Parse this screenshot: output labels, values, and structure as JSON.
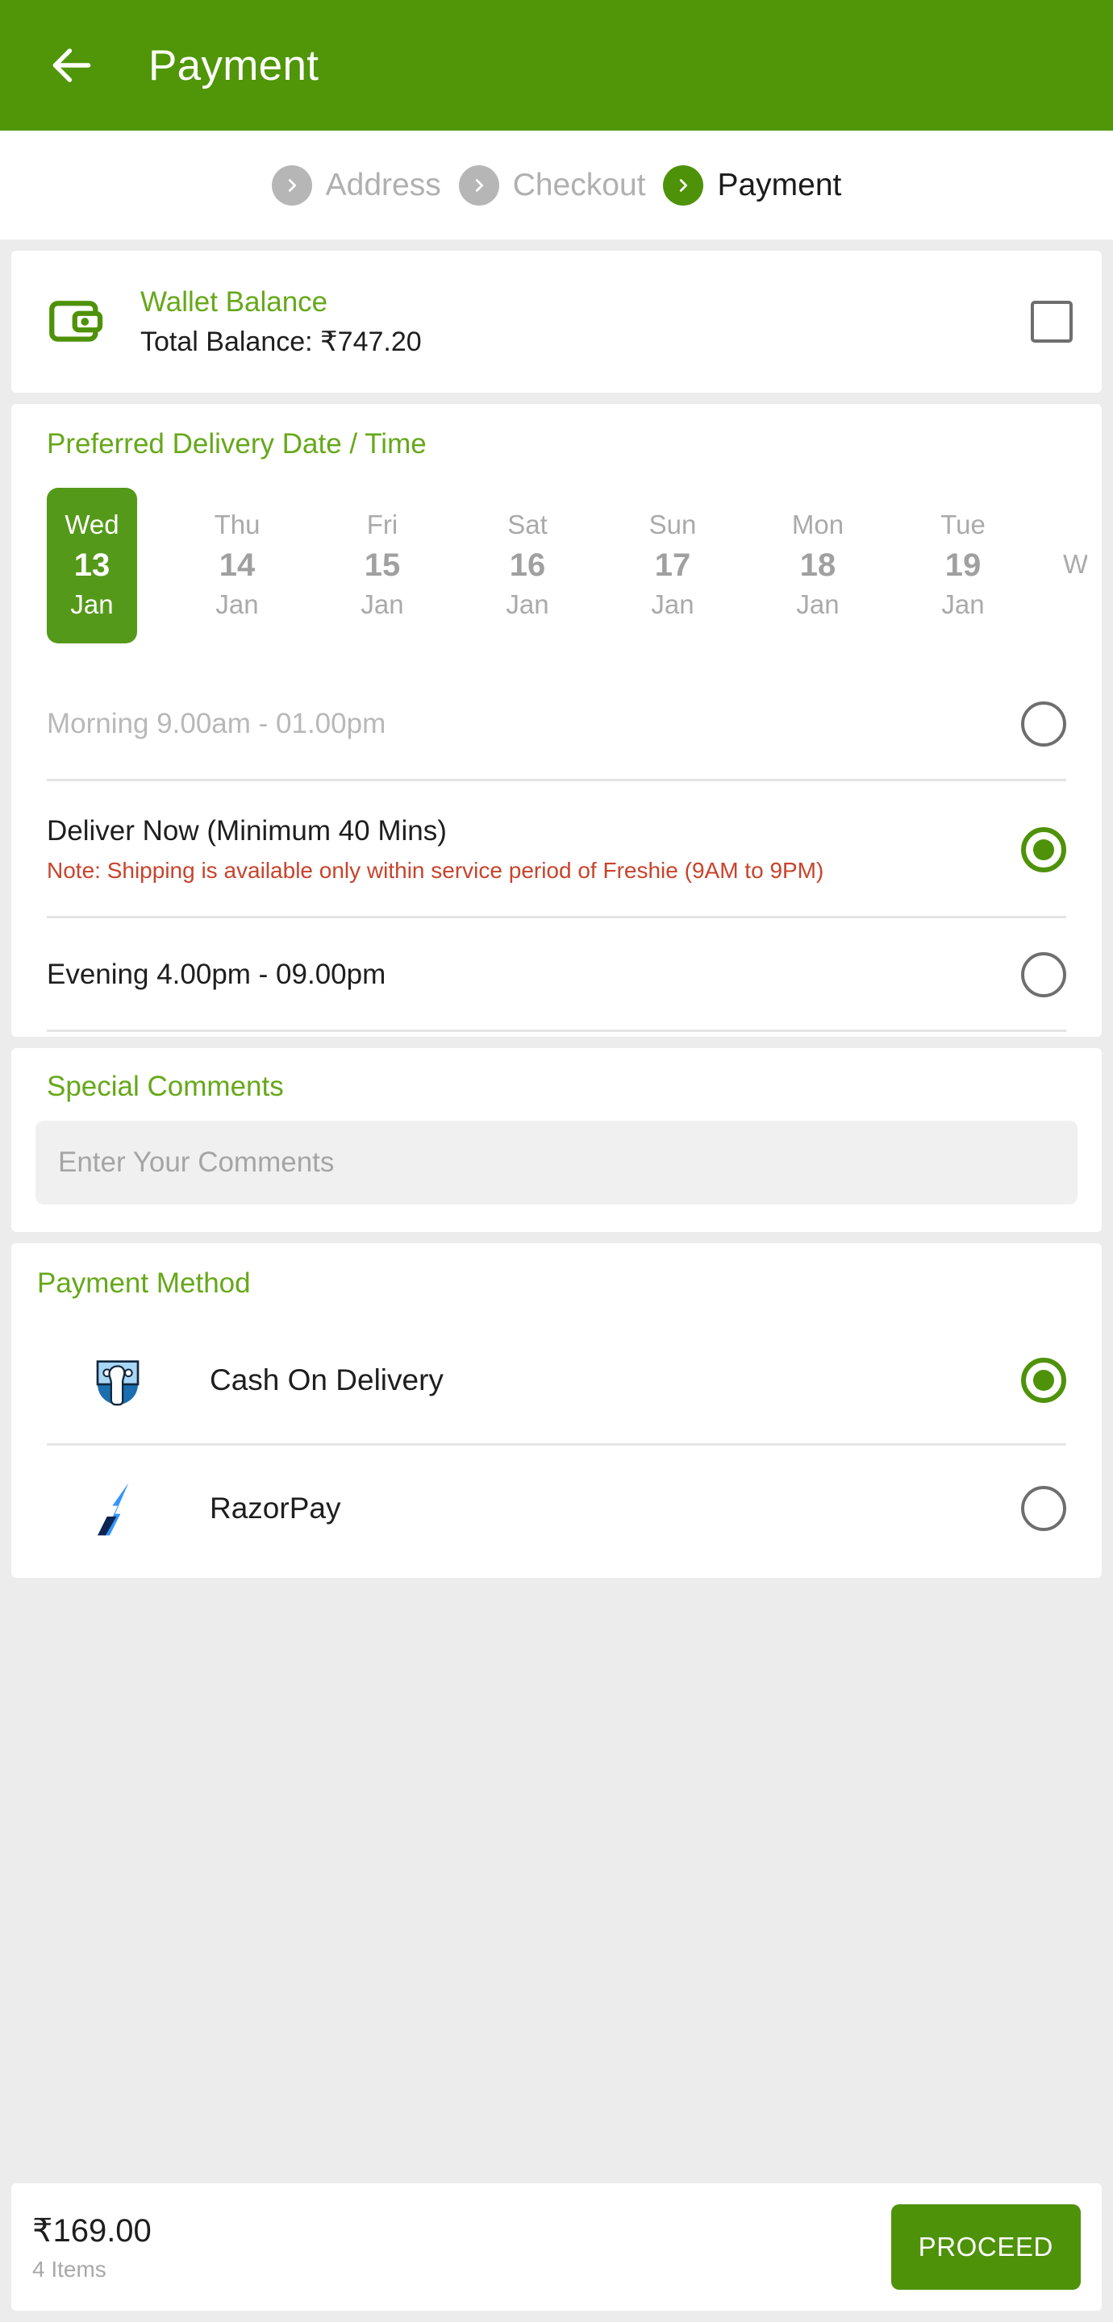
{
  "appbar": {
    "title": "Payment",
    "back_icon": "arrow-left-icon"
  },
  "breadcrumb": {
    "steps": [
      {
        "label": "Address",
        "active": false,
        "icon": "chevron-right-icon"
      },
      {
        "label": "Checkout",
        "active": false,
        "icon": "chevron-right-icon"
      },
      {
        "label": "Payment",
        "active": true,
        "icon": "chevron-right-icon"
      }
    ]
  },
  "wallet": {
    "icon": "wallet-icon",
    "title": "Wallet Balance",
    "balance_label": "Total Balance: ₹747.20",
    "checked": false
  },
  "delivery": {
    "title": "Preferred Delivery Date / Time",
    "dates": [
      {
        "dow": "Wed",
        "day": "13",
        "mon": "Jan",
        "selected": true
      },
      {
        "dow": "Thu",
        "day": "14",
        "mon": "Jan",
        "selected": false
      },
      {
        "dow": "Fri",
        "day": "15",
        "mon": "Jan",
        "selected": false
      },
      {
        "dow": "Sat",
        "day": "16",
        "mon": "Jan",
        "selected": false
      },
      {
        "dow": "Sun",
        "day": "17",
        "mon": "Jan",
        "selected": false
      },
      {
        "dow": "Mon",
        "day": "18",
        "mon": "Jan",
        "selected": false
      },
      {
        "dow": "Tue",
        "day": "19",
        "mon": "Jan",
        "selected": false
      }
    ],
    "partial_next": "W",
    "slots": [
      {
        "label": "Morning 9.00am - 01.00pm",
        "note": "",
        "selected": false,
        "disabled": true
      },
      {
        "label": "Deliver Now (Minimum 40 Mins)",
        "note": "Note: Shipping is available only within service period of Freshie (9AM to 9PM)",
        "selected": true,
        "disabled": false
      },
      {
        "label": "Evening 4.00pm - 09.00pm",
        "note": "",
        "selected": false,
        "disabled": false
      }
    ]
  },
  "comments": {
    "title": "Special Comments",
    "placeholder": "Enter Your Comments",
    "value": ""
  },
  "payment_method": {
    "title": "Payment Method",
    "options": [
      {
        "label": "Cash On Delivery",
        "icon": "cash-on-delivery-icon",
        "selected": true
      },
      {
        "label": "RazorPay",
        "icon": "razorpay-icon",
        "selected": false
      }
    ]
  },
  "bottombar": {
    "total": "₹169.00",
    "items": "4 Items",
    "proceed_label": "PROCEED"
  },
  "colors": {
    "brand_green": "#509608",
    "accent_green": "#4e9209",
    "title_green": "#66a81a",
    "selected_tile_green": "#55991a",
    "note_red": "#c8432c",
    "page_bg": "#ececec"
  }
}
